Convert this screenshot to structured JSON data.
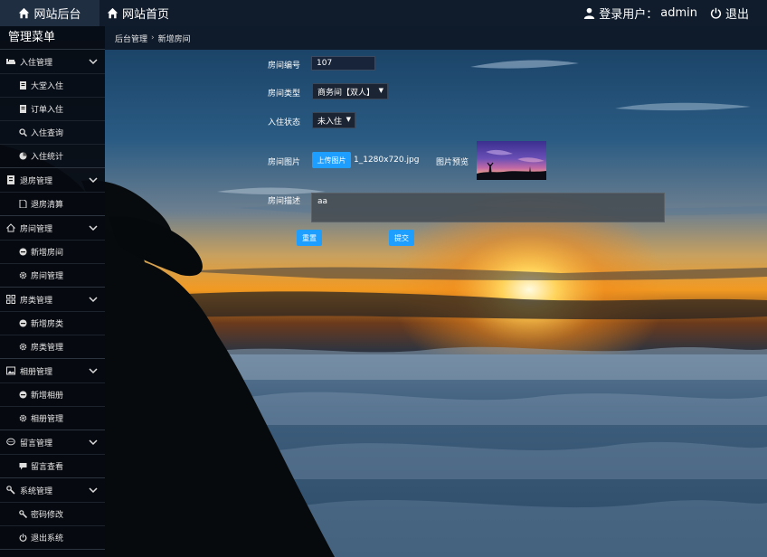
{
  "topbar": {
    "admin_label": "网站后台",
    "home_label": "网站首页",
    "user_label": "登录用户：",
    "username": "admin",
    "logout_label": "退出"
  },
  "sidebar": {
    "title": "管理菜单",
    "groups": [
      {
        "label": "入住管理",
        "icon": "bed-icon",
        "items": [
          {
            "label": "大堂入住",
            "icon": "doc-icon"
          },
          {
            "label": "订单入住",
            "icon": "doc-icon"
          },
          {
            "label": "入住查询",
            "icon": "search-icon"
          },
          {
            "label": "入住统计",
            "icon": "pie-icon"
          }
        ]
      },
      {
        "label": "退房管理",
        "icon": "receipt-icon",
        "items": [
          {
            "label": "退房清算",
            "icon": "file-icon"
          }
        ]
      },
      {
        "label": "房间管理",
        "icon": "home-icon",
        "items": [
          {
            "label": "新增房间",
            "icon": "minus-circle-icon"
          },
          {
            "label": "房间管理",
            "icon": "gear-icon"
          }
        ]
      },
      {
        "label": "房类管理",
        "icon": "grid-icon",
        "items": [
          {
            "label": "新增房类",
            "icon": "minus-circle-icon"
          },
          {
            "label": "房类管理",
            "icon": "gear-icon"
          }
        ]
      },
      {
        "label": "相册管理",
        "icon": "picture-icon",
        "items": [
          {
            "label": "新增相册",
            "icon": "minus-circle-icon"
          },
          {
            "label": "相册管理",
            "icon": "gear-icon"
          }
        ]
      },
      {
        "label": "留言管理",
        "icon": "chat-icon",
        "items": [
          {
            "label": "留言查看",
            "icon": "comment-icon"
          }
        ]
      },
      {
        "label": "系统管理",
        "icon": "tools-icon",
        "items": [
          {
            "label": "密码修改",
            "icon": "wrench-icon"
          },
          {
            "label": "退出系统",
            "icon": "power-icon"
          }
        ]
      }
    ]
  },
  "breadcrumb": {
    "root": "后台管理",
    "separator": "›",
    "current": "新增房间"
  },
  "form": {
    "room_no_label": "房间编号",
    "room_no_value": "107",
    "room_type_label": "房间类型",
    "room_type_value": "商务间【双人】",
    "status_label": "入住状态",
    "status_value": "未入住",
    "image_label": "房间图片",
    "upload_button": "上传图片",
    "file_name": "1_1280x720.jpg",
    "preview_label": "图片预览",
    "desc_label": "房间描述",
    "desc_value": "aa",
    "reset_button": "重置",
    "submit_button": "提交"
  },
  "colors": {
    "accent": "#1e9fff",
    "topbar_bg": "#101c2b",
    "sidebar_bg": "#06090f"
  }
}
